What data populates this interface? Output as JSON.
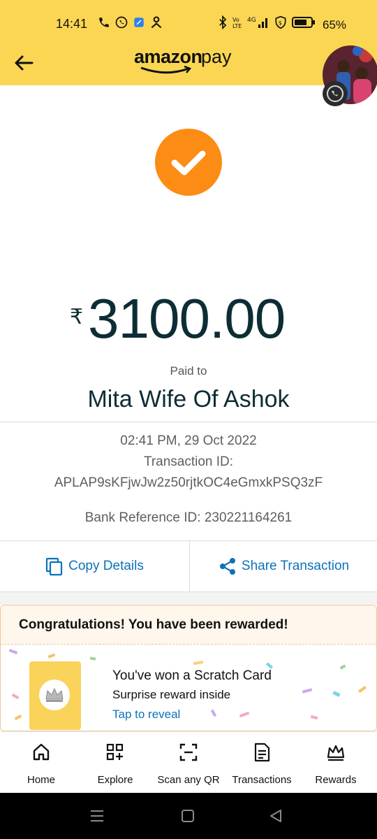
{
  "status_bar": {
    "time": "14:41",
    "battery_text": "65%",
    "left_icons": [
      "phone-icon",
      "whatsapp-icon",
      "app-icon",
      "person-icon"
    ],
    "right_icons": [
      "bluetooth-icon",
      "volte-icon",
      "signal-4g-icon",
      "dollar-shield-icon",
      "battery-icon"
    ]
  },
  "header": {
    "logo_amazon": "amazon",
    "logo_pay": "pay",
    "back_icon": "arrow-left-icon",
    "bg_color": "#fbd653"
  },
  "transaction": {
    "status_icon": "check-circle-icon",
    "currency_symbol": "₹",
    "amount": "3100.00",
    "paid_to_label": "Paid to",
    "payee": "Mita Wife Of Ashok",
    "datetime": "02:41 PM, 29 Oct 2022",
    "transaction_id_label": "Transaction ID:",
    "transaction_id": "APLAP9sKFjwJw2z50rjtkOC4eGmxkPSQ3zF",
    "bank_reference": "Bank Reference ID: 230221164261",
    "accent_color": "#fc8c14"
  },
  "actions": {
    "copy_label": "Copy Details",
    "share_label": "Share Transaction",
    "link_color": "#0d72b9"
  },
  "reward": {
    "title": "Congratulations! You have been rewarded!",
    "line1": "You've won a Scratch Card",
    "line2": "Surprise reward inside",
    "link": "Tap to reveal"
  },
  "bottom_nav": {
    "items": [
      {
        "label": "Home",
        "icon": "home-icon"
      },
      {
        "label": "Explore",
        "icon": "grid-plus-icon"
      },
      {
        "label": "Scan any QR",
        "icon": "scan-qr-icon"
      },
      {
        "label": "Transactions",
        "icon": "document-icon"
      },
      {
        "label": "Rewards",
        "icon": "crown-icon"
      }
    ]
  }
}
